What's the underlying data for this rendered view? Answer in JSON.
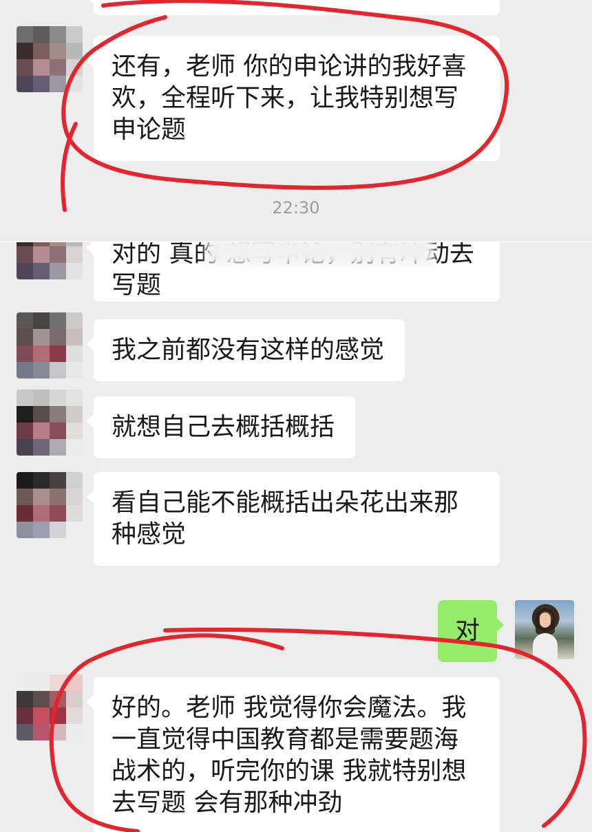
{
  "top_messages": [
    {
      "text": "还有，老师 你的申论讲的我好喜欢，全程听下来，让我特别想写申论题"
    }
  ],
  "timestamp": "22:30",
  "bottom_messages": [
    {
      "text": "对的 真的 想写申论，别有冲动去写题"
    },
    {
      "text": "我之前都没有这样的感觉"
    },
    {
      "text": "就想自己去概括概括"
    },
    {
      "text": "看自己能不能概括出朵花出来那种感觉"
    },
    {
      "text": "对",
      "sent": true
    },
    {
      "text": "好的。老师 我觉得你会魔法。我一直觉得中国教育都是需要题海战术的，听完你的课 我就特别想去写题 会有那种冲劲"
    }
  ],
  "colors": {
    "background": "#ededed",
    "received_bubble": "#ffffff",
    "sent_bubble": "#95ec69",
    "annotation": "#e3262d"
  }
}
